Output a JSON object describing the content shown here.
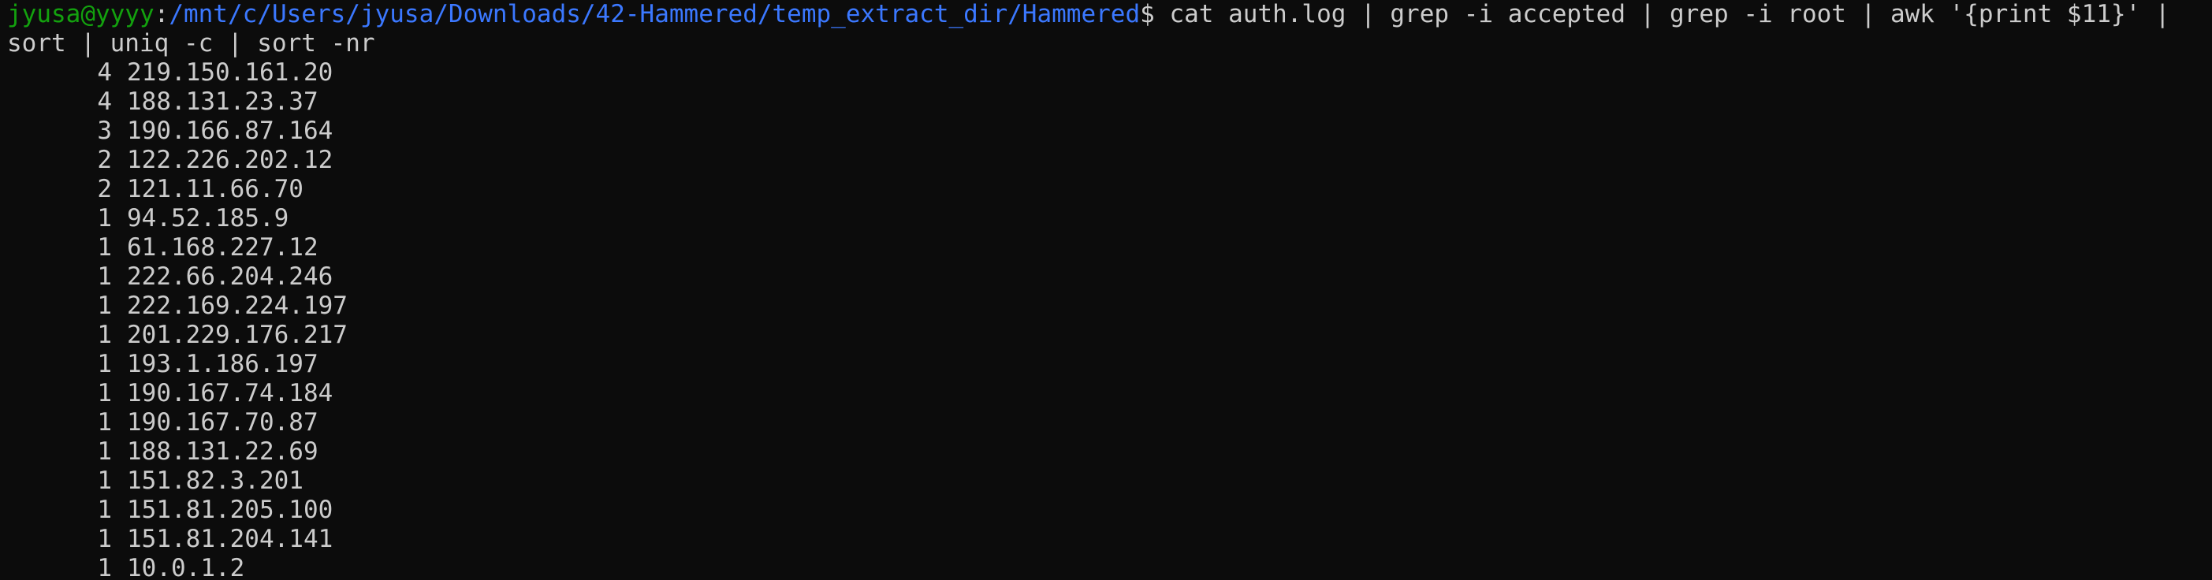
{
  "prompt": {
    "user_host": "jyusa@yyyy",
    "colon": ":",
    "path": "/mnt/c/Users/jyusa/Downloads/42-Hammered/temp_extract_dir/Hammered",
    "symbol": "$ "
  },
  "command": {
    "line1": "cat auth.log | grep -i accepted | grep -i root | awk '{print $11}' |",
    "line2": "sort | uniq -c | sort -nr"
  },
  "output": [
    {
      "count": "4",
      "ip": "219.150.161.20"
    },
    {
      "count": "4",
      "ip": "188.131.23.37"
    },
    {
      "count": "3",
      "ip": "190.166.87.164"
    },
    {
      "count": "2",
      "ip": "122.226.202.12"
    },
    {
      "count": "2",
      "ip": "121.11.66.70"
    },
    {
      "count": "1",
      "ip": "94.52.185.9"
    },
    {
      "count": "1",
      "ip": "61.168.227.12"
    },
    {
      "count": "1",
      "ip": "222.66.204.246"
    },
    {
      "count": "1",
      "ip": "222.169.224.197"
    },
    {
      "count": "1",
      "ip": "201.229.176.217"
    },
    {
      "count": "1",
      "ip": "193.1.186.197"
    },
    {
      "count": "1",
      "ip": "190.167.74.184"
    },
    {
      "count": "1",
      "ip": "190.167.70.87"
    },
    {
      "count": "1",
      "ip": "188.131.22.69"
    },
    {
      "count": "1",
      "ip": "151.82.3.201"
    },
    {
      "count": "1",
      "ip": "151.81.205.100"
    },
    {
      "count": "1",
      "ip": "151.81.204.141"
    },
    {
      "count": "1",
      "ip": "10.0.1.2"
    }
  ],
  "colors": {
    "background": "#0c0c0c",
    "text": "#cccccc",
    "user_host": "#13a10e",
    "path": "#3b78ff"
  }
}
